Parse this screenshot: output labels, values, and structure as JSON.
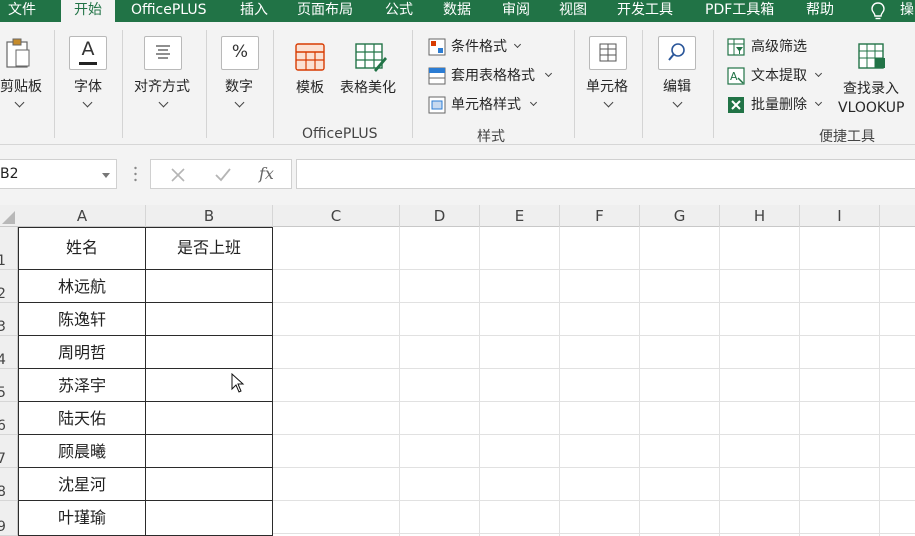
{
  "tabs": [
    "文件",
    "开始",
    "OfficePLUS",
    "插入",
    "页面布局",
    "公式",
    "数据",
    "审阅",
    "视图",
    "开发工具",
    "PDF工具箱",
    "帮助"
  ],
  "tab_more": "操",
  "ribbon": {
    "clipboard": "剪贴板",
    "font": "字体",
    "font_icon_glyph": "A",
    "align": "对齐方式",
    "number": "数字",
    "number_icon_glyph": "%",
    "template": "模板",
    "table_beautify": "表格美化",
    "officeplus_group": "OfficePLUS",
    "conditional_format": "条件格式",
    "table_format": "套用表格格式",
    "cell_style": "单元格样式",
    "style_group": "样式",
    "cells": "单元格",
    "edit": "编辑",
    "advanced_filter": "高级筛选",
    "text_extract": "文本提取",
    "batch_delete": "批量删除",
    "lookup_line1": "查找录入",
    "lookup_line2": "VLOOKUP",
    "shortcut_group": "便捷工具"
  },
  "formula_bar": {
    "name_box": "B2",
    "fx": "fx",
    "formula": ""
  },
  "columns": [
    "A",
    "B",
    "C",
    "D",
    "E",
    "F",
    "G",
    "H",
    "I"
  ],
  "rows": [
    "1",
    "2",
    "3",
    "4",
    "5",
    "6",
    "7",
    "8",
    "9"
  ],
  "table": {
    "headers": [
      "姓名",
      "是否上班"
    ],
    "names": [
      "林远航",
      "陈逸轩",
      "周明哲",
      "苏泽宇",
      "陆天佑",
      "顾晨曦",
      "沈星河",
      "叶瑾瑜"
    ]
  },
  "colors": {
    "ribbon_green": "#217346",
    "ribbon_bg": "#f3f3f3",
    "accent_red": "#d83b01",
    "accent_green": "#217346"
  }
}
